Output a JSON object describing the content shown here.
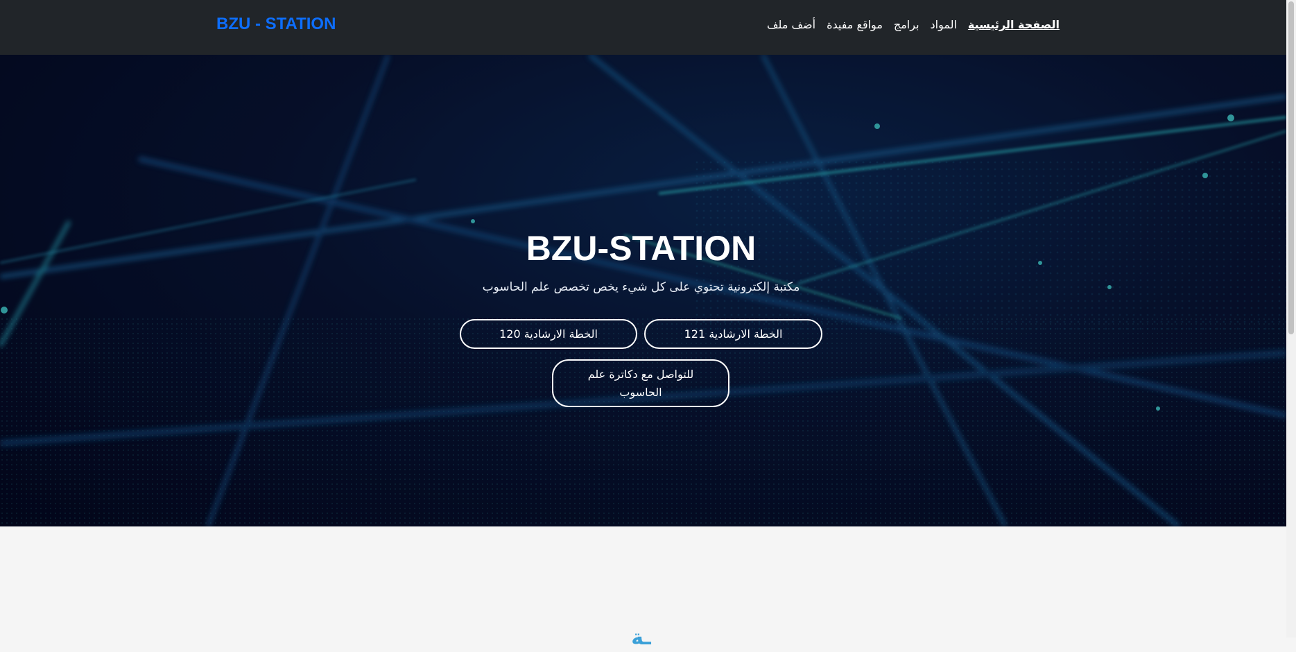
{
  "navbar": {
    "brand": "BZU - STATION",
    "links": [
      {
        "label": "أضف ملف"
      },
      {
        "label": "مواقع مفيدة"
      },
      {
        "label": "برامج"
      },
      {
        "label": "المواد"
      },
      {
        "label": "الصفحة الرئيسية"
      }
    ]
  },
  "hero": {
    "title": "BZU-STATION",
    "subtitle": "مكتبة إلكترونية تحتوي على كل شيء يخص تخصص علم الحاسوب",
    "buttons": [
      {
        "label": "الخطة الارشادية 120"
      },
      {
        "label": "الخطة الارشادية 121"
      },
      {
        "label": "للتواصل مع دكاترة علم الحاسوب"
      }
    ]
  },
  "next_section": {
    "heading": "ـة"
  },
  "colors": {
    "navbar_bg": "#212529",
    "brand": "#0d6efd",
    "hero_dark": "#02051a",
    "section_heading": "#3aa0d8",
    "page_bg": "#f5f5f5"
  }
}
